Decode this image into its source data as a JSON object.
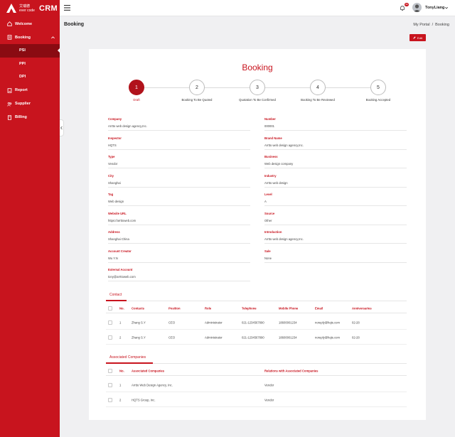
{
  "brand": {
    "logo_cn_line1": "艾瑞德",
    "logo_cn_line2": "ever code",
    "app_name": "CRM",
    "color": "#c8141e"
  },
  "sidebar": {
    "items": [
      {
        "label": "Welcome",
        "icon": "home-icon"
      },
      {
        "label": "Booking",
        "icon": "booking-icon"
      },
      {
        "label": "PSI"
      },
      {
        "label": "PPI"
      },
      {
        "label": "DPI"
      },
      {
        "label": "Report",
        "icon": "report-icon"
      },
      {
        "label": "Supplier",
        "icon": "supplier-icon"
      },
      {
        "label": "Billing",
        "icon": "billing-icon"
      }
    ],
    "active": "PSI"
  },
  "header": {
    "notification_count": "99",
    "username": "TonyLiang"
  },
  "page": {
    "title": "Booking",
    "breadcrumb": [
      "My Portal",
      "Booking"
    ],
    "breadcrumb_sep": "/",
    "edit_label": "Edit"
  },
  "card": {
    "title": "Booking",
    "steps": [
      {
        "num": "1",
        "label": "Draft",
        "active": true
      },
      {
        "num": "2",
        "label": "Booking To Be Quoted"
      },
      {
        "num": "3",
        "label": "Quotation To Be Confirmed"
      },
      {
        "num": "4",
        "label": "Booking To Be Reviewed"
      },
      {
        "num": "5",
        "label": "Booking Accepted"
      }
    ],
    "fields_left": [
      {
        "label": "Company",
        "value": "Arrtto web design agency,Inc."
      },
      {
        "label": "Inspector",
        "value": "HQTS"
      },
      {
        "label": "Type",
        "value": "Vendor"
      },
      {
        "label": "City",
        "value": "Shanghai"
      },
      {
        "label": "Tag",
        "value": "Web design"
      },
      {
        "label": "Website URL",
        "value": "https://arrttoweb.com"
      },
      {
        "label": "Address",
        "value": "Shanghai China"
      },
      {
        "label": "Account Creator",
        "value": "Wu Y.N"
      },
      {
        "label": "External Account",
        "value": "tony@arrttoweb.com"
      }
    ],
    "fields_right": [
      {
        "label": "Number",
        "value": "000001"
      },
      {
        "label": "Brand Name",
        "value": "Arrtto web design agency,Inc."
      },
      {
        "label": "Business",
        "value": "Web design company"
      },
      {
        "label": "Industry",
        "value": "Arrtto web design"
      },
      {
        "label": "Level",
        "value": "A"
      },
      {
        "label": "Source",
        "value": "Other"
      },
      {
        "label": "Introduction",
        "value": "Arrtto web design agency,Inc."
      },
      {
        "label": "Sale",
        "value": "None"
      }
    ],
    "contact": {
      "tab": "Contact",
      "columns": [
        "No.",
        "Contacts",
        "Position",
        "Role",
        "Telephone",
        "Mobile Phone",
        "Email",
        "Anniversaries"
      ],
      "rows": [
        [
          "1",
          "Zhang S.Y",
          "CEO",
          "Administrator",
          "021-1234567890",
          "18600001234",
          "noreply@hqts.com",
          "02-28"
        ],
        [
          "2",
          "Zhang S.Y",
          "CEO",
          "Administrator",
          "021-1234567890",
          "18600001234",
          "noreply@hqts.com",
          "02-28"
        ]
      ]
    },
    "associated": {
      "tab": "Associated Companies",
      "columns": [
        "No.",
        "Associated Companies",
        "Relations with Associated Companies"
      ],
      "rows": [
        [
          "1",
          "Arrtto Web Design Agency, Inc.",
          "Vendor"
        ],
        [
          "2",
          "HQTS Group, Inc.",
          "Vendor"
        ]
      ]
    }
  }
}
